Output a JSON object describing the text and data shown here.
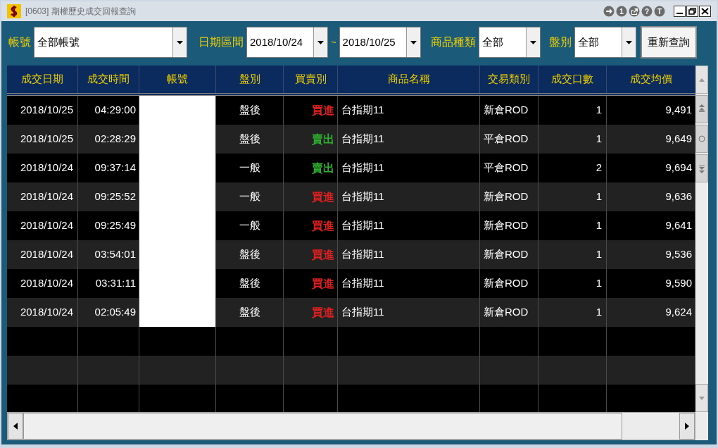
{
  "window": {
    "title": "[0603] 期權歷史成交回報查詢",
    "title_icons": [
      {
        "kind": "arrow"
      },
      {
        "kind": "text",
        "label": "1"
      },
      {
        "kind": "export"
      },
      {
        "kind": "text",
        "label": "?"
      },
      {
        "kind": "text",
        "label": "T"
      }
    ]
  },
  "filters": {
    "account_label": "帳號",
    "account": "全部帳號",
    "date_label": "日期區間",
    "date_from": "2018/10/24",
    "date_sep": "~",
    "date_to": "2018/10/25",
    "product_label": "商品種類",
    "product": "全部",
    "session_label": "盤別",
    "session": "全部",
    "query_button": "重新查詢"
  },
  "table": {
    "columns": [
      "成交日期",
      "成交時間",
      "帳號",
      "盤別",
      "買賣別",
      "商品名稱",
      "交易類別",
      "成交口數",
      "成交均價"
    ],
    "rows": [
      {
        "date": "2018/10/25",
        "time": "04:29:00",
        "account_hidden": true,
        "session": "盤後",
        "side": "買進",
        "color": "#e02020",
        "product": "台指期11",
        "type": "新倉ROD",
        "qty": "1",
        "price": "9,491"
      },
      {
        "date": "2018/10/25",
        "time": "02:28:29",
        "account_hidden": true,
        "session": "盤後",
        "side": "賣出",
        "color": "#30b030",
        "product": "台指期11",
        "type": "平倉ROD",
        "qty": "1",
        "price": "9,649"
      },
      {
        "date": "2018/10/24",
        "time": "09:37:14",
        "account_hidden": true,
        "session": "一般",
        "side": "賣出",
        "color": "#30b030",
        "product": "台指期11",
        "type": "平倉ROD",
        "qty": "2",
        "price": "9,694"
      },
      {
        "date": "2018/10/24",
        "time": "09:25:52",
        "account_hidden": true,
        "session": "一般",
        "side": "買進",
        "color": "#e02020",
        "product": "台指期11",
        "type": "新倉ROD",
        "qty": "1",
        "price": "9,636"
      },
      {
        "date": "2018/10/24",
        "time": "09:25:49",
        "account_hidden": true,
        "session": "一般",
        "side": "買進",
        "color": "#e02020",
        "product": "台指期11",
        "type": "新倉ROD",
        "qty": "1",
        "price": "9,641"
      },
      {
        "date": "2018/10/24",
        "time": "03:54:01",
        "account_hidden": true,
        "session": "盤後",
        "side": "買進",
        "color": "#e02020",
        "product": "台指期11",
        "type": "新倉ROD",
        "qty": "1",
        "price": "9,536"
      },
      {
        "date": "2018/10/24",
        "time": "03:31:11",
        "account_hidden": true,
        "session": "盤後",
        "side": "買進",
        "color": "#e02020",
        "product": "台指期11",
        "type": "新倉ROD",
        "qty": "1",
        "price": "9,590"
      },
      {
        "date": "2018/10/24",
        "time": "02:05:49",
        "account_hidden": true,
        "session": "盤後",
        "side": "買進",
        "color": "#e02020",
        "product": "台指期11",
        "type": "新倉ROD",
        "qty": "1",
        "price": "9,624"
      }
    ]
  }
}
